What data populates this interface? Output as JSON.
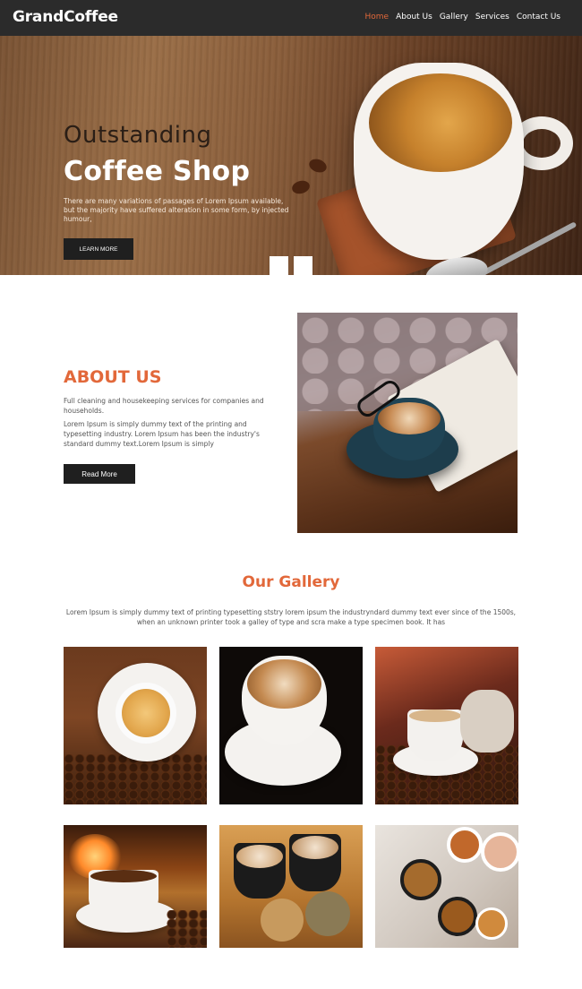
{
  "nav": {
    "logo": "GrandCoffee",
    "items": [
      {
        "label": "Home",
        "active": true
      },
      {
        "label": "About Us",
        "active": false
      },
      {
        "label": "Gallery",
        "active": false
      },
      {
        "label": "Services",
        "active": false
      },
      {
        "label": "Contact Us",
        "active": false
      }
    ]
  },
  "hero": {
    "subtitle": "Outstanding",
    "title": "Coffee Shop",
    "text": "There are many variations of passages of Lorem Ipsum available, but the majority have suffered alteration in some form, by injected humour,",
    "button": "LEARN MORE"
  },
  "about": {
    "title": "ABOUT US",
    "p1": "Full cleaning and housekeeping services for companies and households.",
    "p2": "Lorem Ipsum is simply dummy text of the printing and typesetting industry. Lorem Ipsum has been the industry's standard dummy text.Lorem Ipsum is simply",
    "button": "Read More"
  },
  "gallery": {
    "title": "Our Gallery",
    "text": "Lorem Ipsum is simply dummy text of printing typesetting ststry lorem ipsum the industryndard dummy text ever since of the 1500s, when an unknown printer took a galley of type and scra make a type specimen book. It has"
  },
  "colors": {
    "accent": "#e2683a",
    "nav_bg": "#2b2b2b",
    "button_bg": "#1f1f1f"
  }
}
